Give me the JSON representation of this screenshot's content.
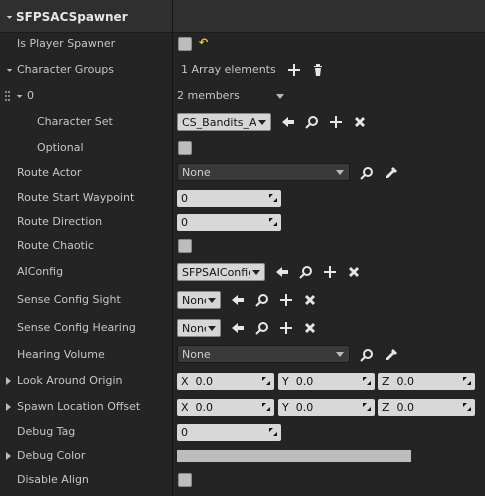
{
  "panel": {
    "title": "SFPSACSpawner"
  },
  "rows": {
    "is_player_spawner": {
      "label": "Is Player Spawner",
      "reset_icon": "↶"
    },
    "character_groups": {
      "label": "Character Groups",
      "value": "1 Array elements"
    },
    "index_0": {
      "label": "0",
      "value": "2 members"
    },
    "character_set": {
      "label": "Character Set",
      "value": "CS_Bandits_All"
    },
    "optional": {
      "label": "Optional"
    },
    "route_actor": {
      "label": "Route Actor",
      "value": "None"
    },
    "route_start_waypoint": {
      "label": "Route Start Waypoint",
      "value": "0"
    },
    "route_direction": {
      "label": "Route Direction",
      "value": "0"
    },
    "route_chaotic": {
      "label": "Route Chaotic"
    },
    "ai_config": {
      "label": "AIConfig",
      "value": "SFPSAIConfig"
    },
    "sense_config_sight": {
      "label": "Sense Config Sight",
      "value": "None"
    },
    "sense_config_hearing": {
      "label": "Sense Config Hearing",
      "value": "None"
    },
    "hearing_volume": {
      "label": "Hearing Volume",
      "value": "None"
    },
    "look_around_origin": {
      "label": "Look Around Origin",
      "x_label": "X",
      "x": "0.0",
      "y_label": "Y",
      "y": "0.0",
      "z_label": "Z",
      "z": "0.0"
    },
    "spawn_location_offset": {
      "label": "Spawn Location Offset",
      "x_label": "X",
      "x": "0.0",
      "y_label": "Y",
      "y": "0.0",
      "z_label": "Z",
      "z": "0.0"
    },
    "debug_tag": {
      "label": "Debug Tag",
      "value": "0"
    },
    "debug_color": {
      "label": "Debug Color"
    },
    "disable_align": {
      "label": "Disable Align"
    }
  }
}
